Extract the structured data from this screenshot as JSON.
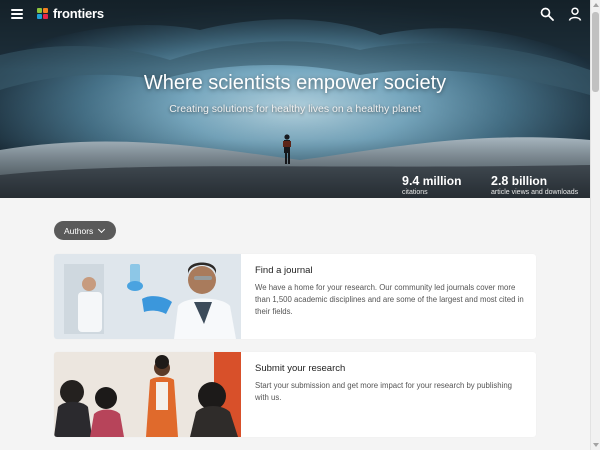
{
  "brand": {
    "name": "frontiers"
  },
  "hero": {
    "title": "Where scientists empower society",
    "subtitle": "Creating solutions for healthy lives on a healthy planet",
    "stats": [
      {
        "value": "9.4",
        "unit": "million",
        "label": "citations"
      },
      {
        "value": "2.8",
        "unit": "billion",
        "label": "article views and downloads"
      }
    ]
  },
  "filter": {
    "label": "Authors"
  },
  "cards": [
    {
      "title": "Find a journal",
      "description": "We have a home for your research. Our community led journals cover more than 1,500 academic disciplines and are some of the largest and most cited in their fields."
    },
    {
      "title": "Submit your research",
      "description": "Start your submission and get more impact for your research by publishing with us."
    }
  ],
  "icons": {
    "menu": "menu-icon",
    "search": "search-icon",
    "user": "user-icon",
    "chevron": "chevron-down-icon"
  },
  "colors": {
    "logo_green": "#8cc63f",
    "logo_orange": "#f58220",
    "logo_blue": "#1ea1d6",
    "logo_red": "#e5264a",
    "chip_bg": "#5a5a5a",
    "page_bg": "#f4f4f4"
  }
}
